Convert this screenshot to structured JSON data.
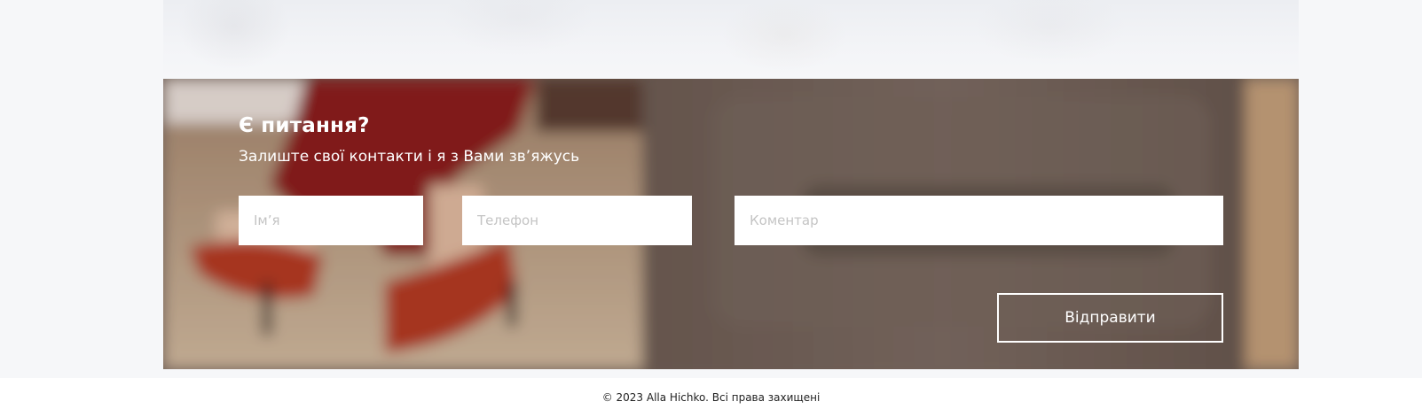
{
  "contact": {
    "heading": "Є питання?",
    "subheading": "Залиште свої контакти і я з Вами зв’яжусь",
    "fields": {
      "name_placeholder": "Ім’я",
      "phone_placeholder": "Телефон",
      "comment_placeholder": "Коментар"
    },
    "submit_label": "Відправити"
  },
  "footer": {
    "copyright": "© 2023 Alla Hichko. Всі права захищені"
  },
  "colors": {
    "page_background": "#f6f7f9",
    "button_border": "#ffffff",
    "text_on_banner": "#ffffff"
  }
}
